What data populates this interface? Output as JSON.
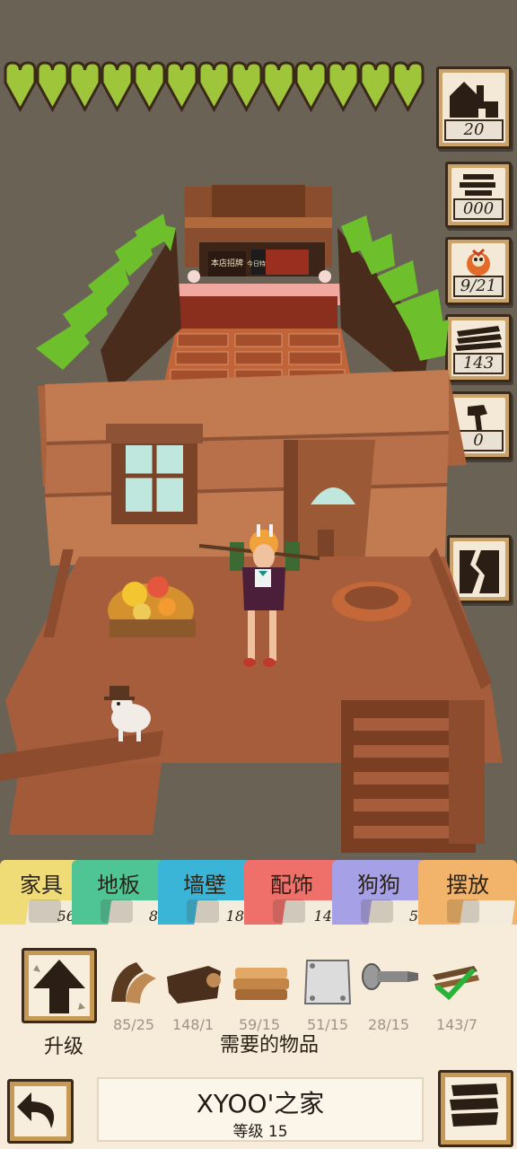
{
  "health": {
    "hearts": 13,
    "color": "#9fc63a"
  },
  "resources": [
    {
      "id": "house",
      "icon": "house-icon",
      "value": "20"
    },
    {
      "id": "planks",
      "icon": "sign-icon",
      "value": "000"
    },
    {
      "id": "creature",
      "icon": "chicken-icon",
      "value": "9/21"
    },
    {
      "id": "wood",
      "icon": "wood-planks-icon",
      "value": "143"
    },
    {
      "id": "axe",
      "icon": "axe-icon",
      "value": "0"
    }
  ],
  "scene": {
    "stall_sign_left": "本店招牌",
    "stall_sign_right": "今日特价"
  },
  "tabs": [
    {
      "label": "家具",
      "count": "56",
      "color": "#f0dc76"
    },
    {
      "label": "地板",
      "count": "8",
      "color": "#4fc596"
    },
    {
      "label": "墙壁",
      "count": "18",
      "color": "#3ab5d8"
    },
    {
      "label": "配饰",
      "count": "14",
      "color": "#ef6f6a"
    },
    {
      "label": "狗狗",
      "count": "5",
      "color": "#a6a0e6"
    },
    {
      "label": "摆放",
      "count": "",
      "color": "#f2b46a"
    }
  ],
  "upgrade": {
    "label": "升级"
  },
  "required_items": [
    {
      "name": "wood-beam",
      "count": "85/25"
    },
    {
      "name": "log",
      "count": "148/1"
    },
    {
      "name": "plank-stack",
      "count": "59/15"
    },
    {
      "name": "metal-plate",
      "count": "51/15"
    },
    {
      "name": "screw",
      "count": "28/15"
    },
    {
      "name": "wood-planks-check",
      "count": "143/7"
    }
  ],
  "needed_label": "需要的物品",
  "house": {
    "name": "XYOO'之家",
    "level": "等级 15"
  }
}
